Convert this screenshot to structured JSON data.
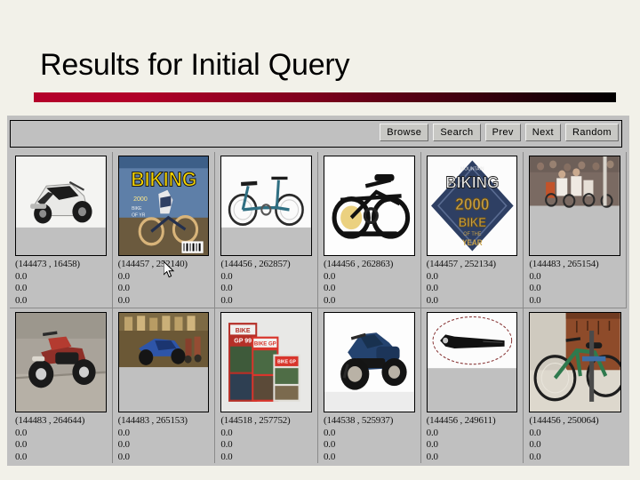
{
  "slide": {
    "title": "Results for Initial Query",
    "accent_color": "#b4002a",
    "accent_end_color": "#000000",
    "background_color": "#f2f1e9"
  },
  "app": {
    "background_color": "#c0c0c0",
    "toolbar": {
      "buttons": [
        {
          "label": "Browse",
          "name": "browse-button"
        },
        {
          "label": "Search",
          "name": "search-button"
        },
        {
          "label": "Prev",
          "name": "prev-button"
        },
        {
          "label": "Next",
          "name": "next-button"
        },
        {
          "label": "Random",
          "name": "random-button"
        }
      ]
    },
    "results": [
      {
        "coord": "(144473 , 16458)",
        "scores": [
          "0.0",
          "0.0",
          "0.0"
        ],
        "thumbnail": "white-motor-scooter-photo"
      },
      {
        "coord": "(144457 , 252140)",
        "scores": [
          "0.0",
          "0.0",
          "0.0"
        ],
        "thumbnail": "biking-magazine-cover"
      },
      {
        "coord": "(144456 , 262857)",
        "scores": [
          "0.0",
          "0.0",
          "0.0"
        ],
        "thumbnail": "folding-bicycle-side-view"
      },
      {
        "coord": "(144456 , 262863)",
        "scores": [
          "0.0",
          "0.0",
          "0.0"
        ],
        "thumbnail": "folded-black-bicycle"
      },
      {
        "coord": "(144457 , 252134)",
        "scores": [
          "0.0",
          "0.0",
          "0.0"
        ],
        "thumbnail": "biking-2000-bike-of-the-year-award"
      },
      {
        "coord": "(144483 , 265154)",
        "scores": [
          "0.0",
          "0.0",
          "0.0"
        ],
        "thumbnail": "bicycle-race-crowd-photo"
      },
      {
        "coord": "(144483 , 264644)",
        "scores": [
          "0.0",
          "0.0",
          "0.0"
        ],
        "thumbnail": "red-motorcycle-on-street"
      },
      {
        "coord": "(144483 , 265153)",
        "scores": [
          "0.0",
          "0.0",
          "0.0"
        ],
        "thumbnail": "blue-scooter-showroom"
      },
      {
        "coord": "(144518 , 257752)",
        "scores": [
          "0.0",
          "0.0",
          "0.0"
        ],
        "thumbnail": "bike-gp-99-video-boxes"
      },
      {
        "coord": "(144538 , 525937)",
        "scores": [
          "0.0",
          "0.0",
          "0.0"
        ],
        "thumbnail": "blue-touring-motorcycle"
      },
      {
        "coord": "(144456 , 249611)",
        "scores": [
          "0.0",
          "0.0",
          "0.0"
        ],
        "thumbnail": "black-bike-part-in-oval"
      },
      {
        "coord": "(144456 , 250064)",
        "scores": [
          "0.0",
          "0.0",
          "0.0"
        ],
        "thumbnail": "green-bicycle-on-rack"
      }
    ]
  },
  "pointer": {
    "name": "mouse-cursor"
  }
}
